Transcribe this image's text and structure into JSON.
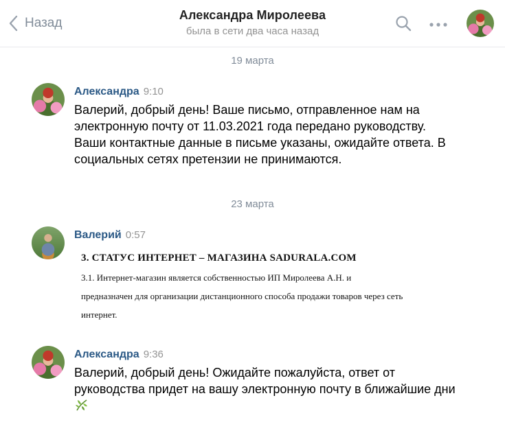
{
  "header": {
    "back_label": "Назад",
    "title": "Александра Миролеева",
    "subtitle": "была в сети два часа назад",
    "icons": {
      "back": "chevron-left-icon",
      "search": "search-icon",
      "more": "more-dots-icon"
    }
  },
  "messages": [
    {
      "date": "19 марта",
      "author": "Александра",
      "time": "9:10",
      "text": "Валерий, добрый день! Ваше письмо, отправленное нам на электронную почту от 11.03.2021 года передано руководству. Ваши контактные данные в письме указаны, ожидайте ответа. В социальных сетях претензии не принимаются."
    },
    {
      "date": "23 марта",
      "author": "Валерий",
      "time": "0:57",
      "attachment": {
        "heading": "3. СТАТУС ИНТЕРНЕТ – МАГАЗИНА SADURALA.COM",
        "body": "3.1. Интернет-магазин является собственностью ИП Миролеева А.Н. и предназначен для организации дистанционного способа продажи товаров через сеть интернет."
      }
    },
    {
      "author": "Александра",
      "time": "9:36",
      "text": "Валерий, добрый день! Ожидайте пожалуйста, ответ от руководства придет на вашу электронную почту в ближайшие дни",
      "emoji": "herb-emoji"
    }
  ],
  "colors": {
    "accent": "#2a5885",
    "muted": "#818c99",
    "divider": "#e7e8ec"
  }
}
